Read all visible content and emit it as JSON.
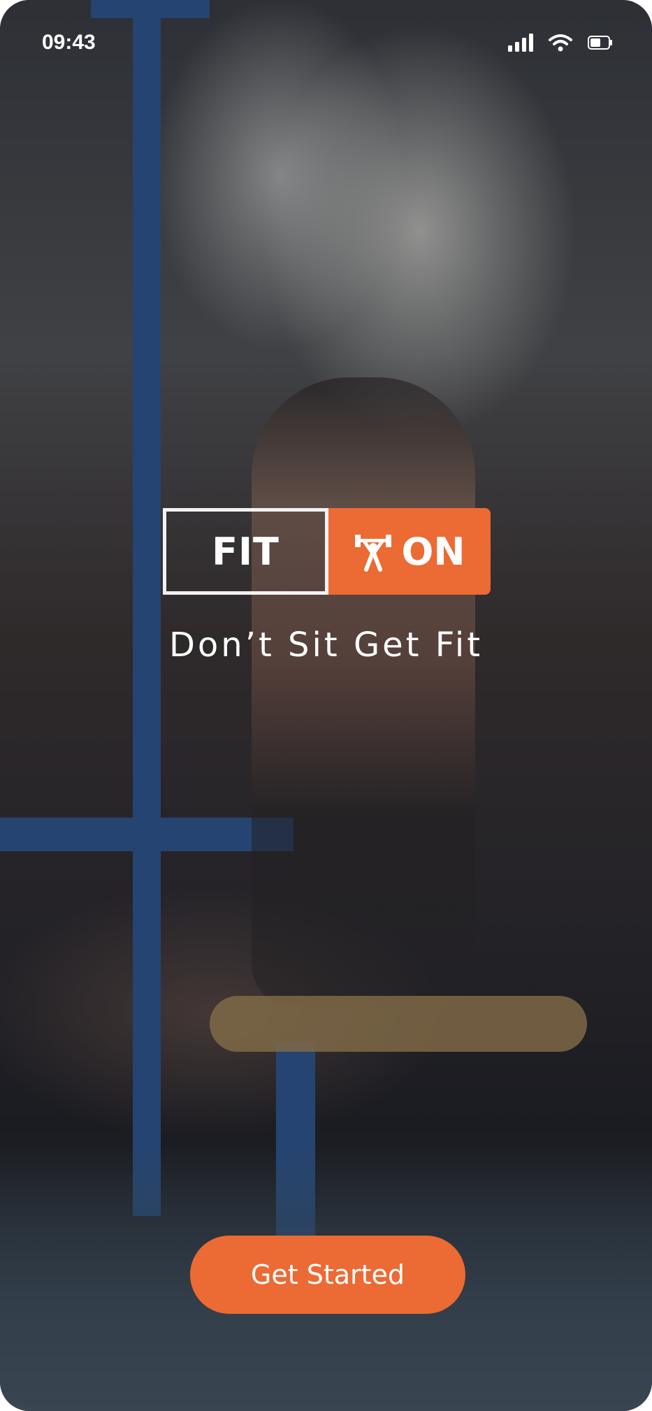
{
  "status_bar": {
    "time": "09:43",
    "icons": [
      "cellular-signal-icon",
      "wifi-icon",
      "battery-icon"
    ]
  },
  "logo": {
    "left_text": "FIT",
    "right_text": "ON",
    "icon": "weightlifter-icon"
  },
  "tagline": "Don’t Sit Get Fit",
  "cta": {
    "label": "Get Started"
  },
  "colors": {
    "accent": "#EC6A33",
    "text": "#FFFFFF"
  }
}
